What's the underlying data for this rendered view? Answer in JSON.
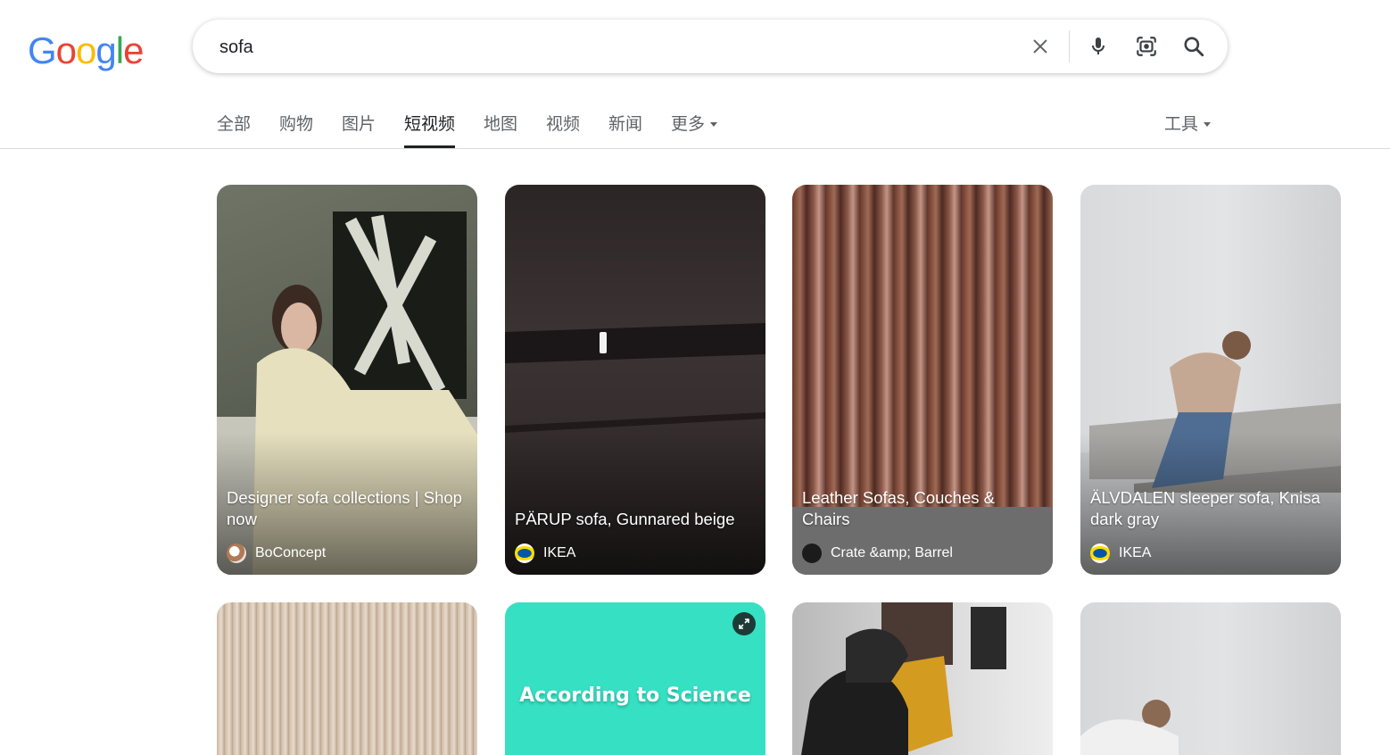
{
  "logo": {
    "letters": [
      "G",
      "o",
      "o",
      "g",
      "l",
      "e"
    ],
    "colors": [
      "#4285F4",
      "#EA4335",
      "#FBBC05",
      "#4285F4",
      "#34A853",
      "#EA4335"
    ]
  },
  "search": {
    "query": "sofa"
  },
  "tabs": [
    {
      "label": "全部"
    },
    {
      "label": "购物"
    },
    {
      "label": "图片"
    },
    {
      "label": "短视频",
      "active": true
    },
    {
      "label": "地图"
    },
    {
      "label": "视频"
    },
    {
      "label": "新闻"
    },
    {
      "label": "更多"
    }
  ],
  "tools": {
    "label": "工具"
  },
  "results": [
    {
      "title": "Designer sofa collections | Shop now",
      "source": "BoConcept"
    },
    {
      "title": "PÄRUP sofa, Gunnared beige",
      "source": "IKEA"
    },
    {
      "title": "Leather Sofas, Couches & Chairs",
      "source": "Crate &amp; Barrel"
    },
    {
      "title": "ÄLVDALEN sleeper sofa, Knisa dark gray",
      "source": "IKEA"
    }
  ],
  "second_row": [
    {
      "overlay_text": "According to Science"
    },
    {
      "overlay_text": ""
    },
    {
      "overlay_text": ""
    },
    {
      "overlay_text": ""
    }
  ]
}
